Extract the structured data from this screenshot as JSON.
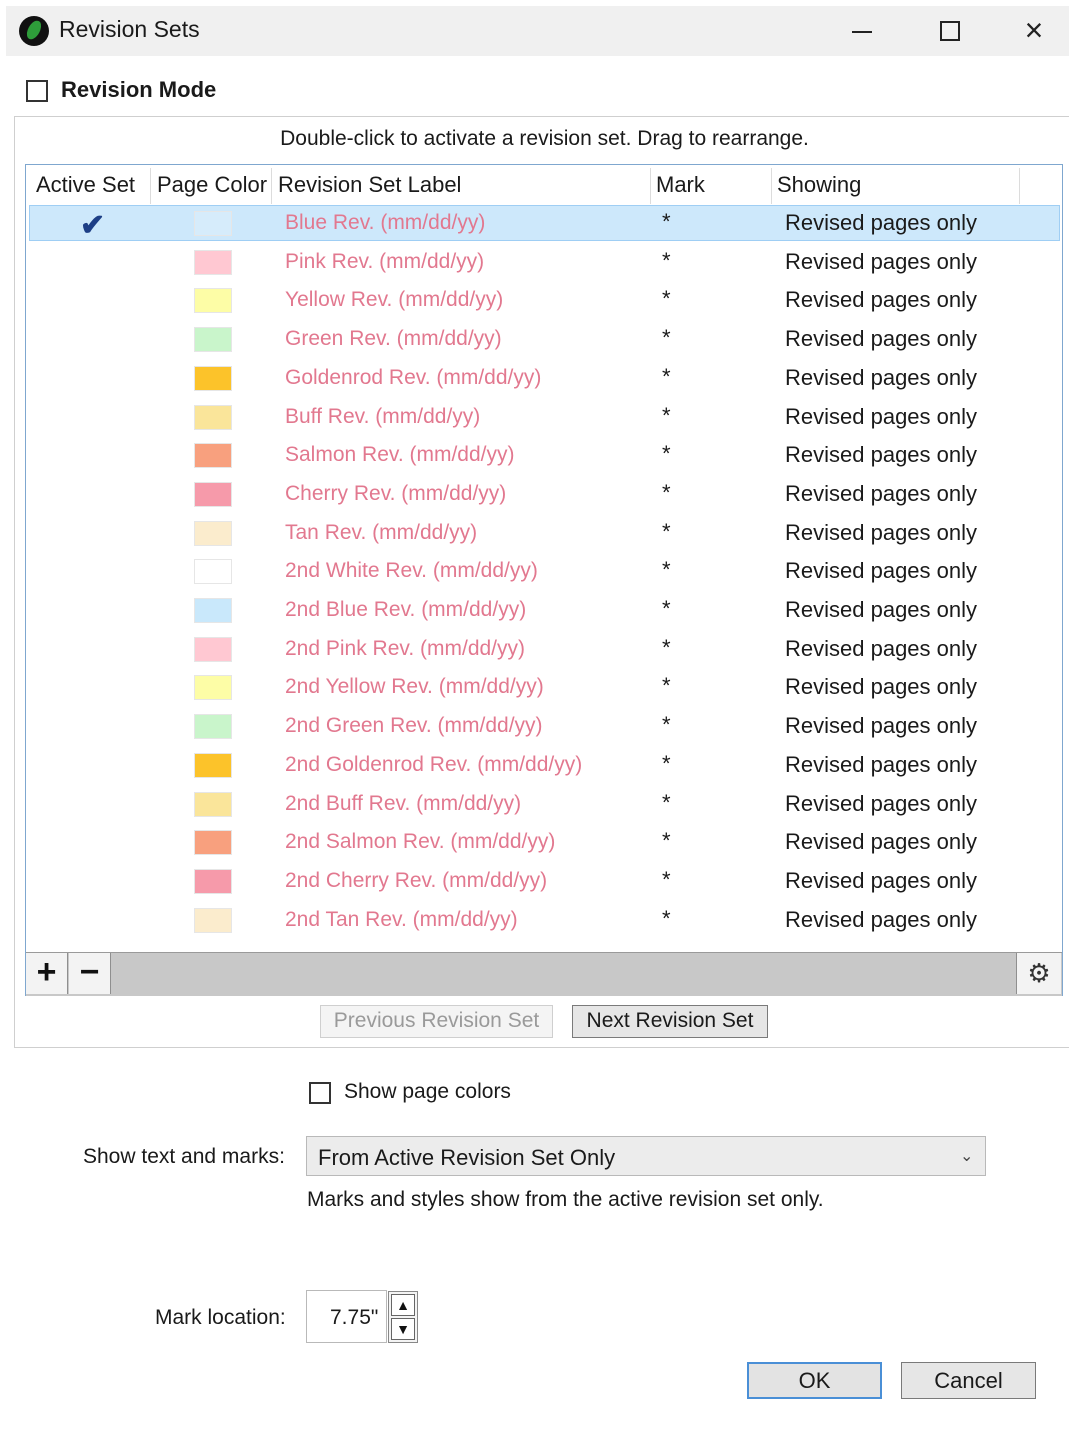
{
  "window": {
    "title": "Revision Sets"
  },
  "revision_mode": {
    "label": "Revision Mode",
    "checked": false
  },
  "hint": {
    "text": "Double-click to activate a revision set. Drag to rearrange."
  },
  "table": {
    "columns": [
      "Active Set",
      "Page Color",
      "Revision Set Label",
      "Mark",
      "Showing"
    ],
    "label_color": "#e2788f",
    "rows": [
      {
        "active": true,
        "color": "#d6ecfb",
        "label": "Blue Rev. (mm/dd/yy)",
        "mark": "*",
        "showing": "Revised pages only"
      },
      {
        "active": false,
        "color": "#ffc8d2",
        "label": "Pink Rev. (mm/dd/yy)",
        "mark": "*",
        "showing": "Revised pages only"
      },
      {
        "active": false,
        "color": "#fdfda6",
        "label": "Yellow Rev. (mm/dd/yy)",
        "mark": "*",
        "showing": "Revised pages only"
      },
      {
        "active": false,
        "color": "#c9f5cb",
        "label": "Green Rev. (mm/dd/yy)",
        "mark": "*",
        "showing": "Revised pages only"
      },
      {
        "active": false,
        "color": "#fcc32a",
        "label": "Goldenrod Rev. (mm/dd/yy)",
        "mark": "*",
        "showing": "Revised pages only"
      },
      {
        "active": false,
        "color": "#fae59a",
        "label": "Buff Rev. (mm/dd/yy)",
        "mark": "*",
        "showing": "Revised pages only"
      },
      {
        "active": false,
        "color": "#f8a07e",
        "label": "Salmon Rev. (mm/dd/yy)",
        "mark": "*",
        "showing": "Revised pages only"
      },
      {
        "active": false,
        "color": "#f69aaa",
        "label": "Cherry Rev. (mm/dd/yy)",
        "mark": "*",
        "showing": "Revised pages only"
      },
      {
        "active": false,
        "color": "#fbeccd",
        "label": "Tan Rev. (mm/dd/yy)",
        "mark": "*",
        "showing": "Revised pages only"
      },
      {
        "active": false,
        "color": "#ffffff",
        "label": "2nd White Rev. (mm/dd/yy)",
        "mark": "*",
        "showing": "Revised pages only"
      },
      {
        "active": false,
        "color": "#c9e8fb",
        "label": "2nd Blue Rev. (mm/dd/yy)",
        "mark": "*",
        "showing": "Revised pages only"
      },
      {
        "active": false,
        "color": "#ffc8d2",
        "label": "2nd Pink Rev. (mm/dd/yy)",
        "mark": "*",
        "showing": "Revised pages only"
      },
      {
        "active": false,
        "color": "#fdfda6",
        "label": "2nd Yellow Rev. (mm/dd/yy)",
        "mark": "*",
        "showing": "Revised pages only"
      },
      {
        "active": false,
        "color": "#c9f5cb",
        "label": "2nd Green Rev. (mm/dd/yy)",
        "mark": "*",
        "showing": "Revised pages only"
      },
      {
        "active": false,
        "color": "#fcc32a",
        "label": "2nd Goldenrod Rev. (mm/dd/yy)",
        "mark": "*",
        "showing": "Revised pages only"
      },
      {
        "active": false,
        "color": "#fae59a",
        "label": "2nd Buff Rev. (mm/dd/yy)",
        "mark": "*",
        "showing": "Revised pages only"
      },
      {
        "active": false,
        "color": "#f8a07e",
        "label": "2nd Salmon Rev. (mm/dd/yy)",
        "mark": "*",
        "showing": "Revised pages only"
      },
      {
        "active": false,
        "color": "#f69aaa",
        "label": "2nd Cherry Rev. (mm/dd/yy)",
        "mark": "*",
        "showing": "Revised pages only"
      },
      {
        "active": false,
        "color": "#fbeccd",
        "label": "2nd Tan Rev. (mm/dd/yy)",
        "mark": "*",
        "showing": "Revised pages only"
      }
    ]
  },
  "toolbar": {
    "add_label": "+",
    "remove_label": "−",
    "settings_icon": "gear-icon"
  },
  "nav": {
    "previous_label": "Previous Revision Set",
    "next_label": "Next Revision Set"
  },
  "show_page_colors": {
    "label": "Show page colors",
    "checked": false
  },
  "show_text_marks": {
    "label": "Show text and marks:",
    "selected": "From Active Revision Set Only",
    "description": "Marks and styles show from the active revision set only."
  },
  "mark_location": {
    "label": "Mark location:",
    "value": "7.75\""
  },
  "buttons": {
    "ok": "OK",
    "cancel": "Cancel"
  }
}
